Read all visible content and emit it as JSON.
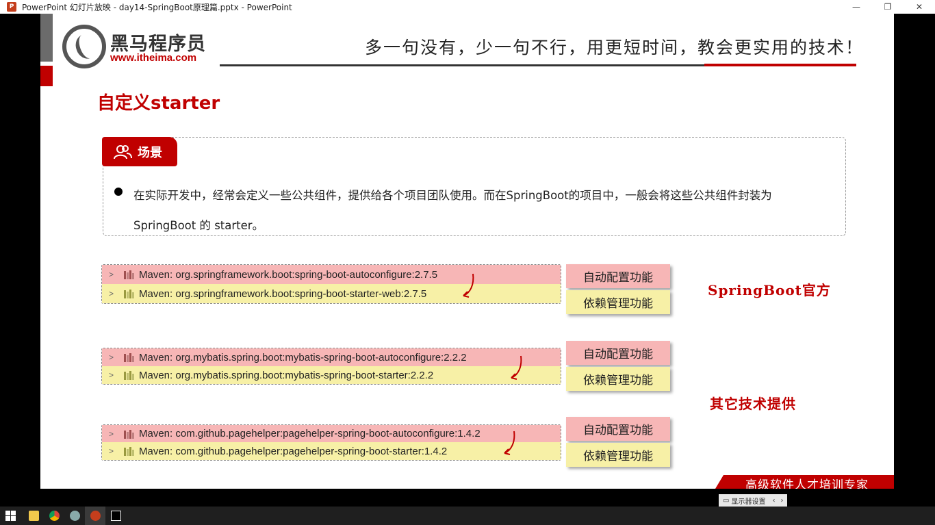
{
  "window": {
    "title": "PowerPoint 幻灯片放映  -  day14-SpringBoot原理篇.pptx - PowerPoint",
    "app_icon": "P",
    "controls": [
      "—",
      "❐",
      "✕"
    ]
  },
  "slide": {
    "logo": {
      "name": "黑马程序员",
      "url": "www.itheima.com"
    },
    "slogan": "多一句没有，少一句不行，用更短时间，教会更实用的技术！",
    "title": "自定义starter",
    "scene": {
      "tab_label": "场景",
      "text": "在实际开发中，经常会定义一些公共组件，提供给各个项目团队使用。而在SpringBoot的项目中，一般会将这些公共组件封装为SpringBoot 的 starter。"
    },
    "groups": [
      {
        "autoconfigure": "Maven: org.springframework.boot:spring-boot-autoconfigure:2.7.5",
        "starter": "Maven: org.springframework.boot:spring-boot-starter-web:2.7.5"
      },
      {
        "autoconfigure": "Maven: org.mybatis.spring.boot:mybatis-spring-boot-autoconfigure:2.2.2",
        "starter": "Maven: org.mybatis.spring.boot:mybatis-spring-boot-starter:2.2.2"
      },
      {
        "autoconfigure": "Maven: com.github.pagehelper:pagehelper-spring-boot-autoconfigure:1.4.2",
        "starter": "Maven: com.github.pagehelper:pagehelper-spring-boot-starter:1.4.2"
      }
    ],
    "func_labels": {
      "auto": "自动配置功能",
      "dep": "依赖管理功能"
    },
    "notes": {
      "official": "SpringBoot官方",
      "other": "其它技术提供"
    },
    "footer": "高级软件人才培训专家"
  },
  "slideshow_bar": {
    "label": "显示器设置"
  },
  "colors": {
    "brand_red": "#c00000",
    "pink": "#f7b6b6",
    "yellow": "#f7f0a6"
  }
}
